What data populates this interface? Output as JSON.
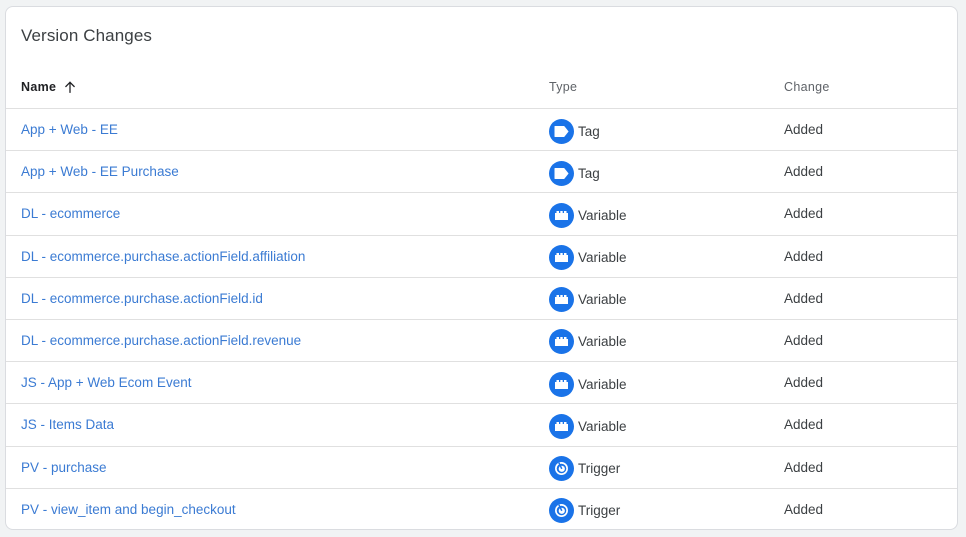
{
  "card": {
    "title": "Version Changes"
  },
  "columns": {
    "name": "Name",
    "type": "Type",
    "change": "Change"
  },
  "rows": [
    {
      "name": "App + Web - EE",
      "type": "Tag",
      "icon": "tag-icon",
      "change": "Added"
    },
    {
      "name": "App + Web - EE Purchase",
      "type": "Tag",
      "icon": "tag-icon",
      "change": "Added"
    },
    {
      "name": "DL - ecommerce",
      "type": "Variable",
      "icon": "variable-icon",
      "change": "Added"
    },
    {
      "name": "DL - ecommerce.purchase.actionField.affiliation",
      "type": "Variable",
      "icon": "variable-icon",
      "change": "Added"
    },
    {
      "name": "DL - ecommerce.purchase.actionField.id",
      "type": "Variable",
      "icon": "variable-icon",
      "change": "Added"
    },
    {
      "name": "DL - ecommerce.purchase.actionField.revenue",
      "type": "Variable",
      "icon": "variable-icon",
      "change": "Added"
    },
    {
      "name": "JS - App + Web Ecom Event",
      "type": "Variable",
      "icon": "variable-icon",
      "change": "Added"
    },
    {
      "name": "JS - Items Data",
      "type": "Variable",
      "icon": "variable-icon",
      "change": "Added"
    },
    {
      "name": "PV - purchase",
      "type": "Trigger",
      "icon": "trigger-icon",
      "change": "Added"
    },
    {
      "name": "PV - view_item and begin_checkout",
      "type": "Trigger",
      "icon": "trigger-icon",
      "change": "Added"
    }
  ],
  "colors": {
    "link": "#3b7bd3",
    "icon_bg": "#1a73e8",
    "divider": "#e0e0e0"
  }
}
